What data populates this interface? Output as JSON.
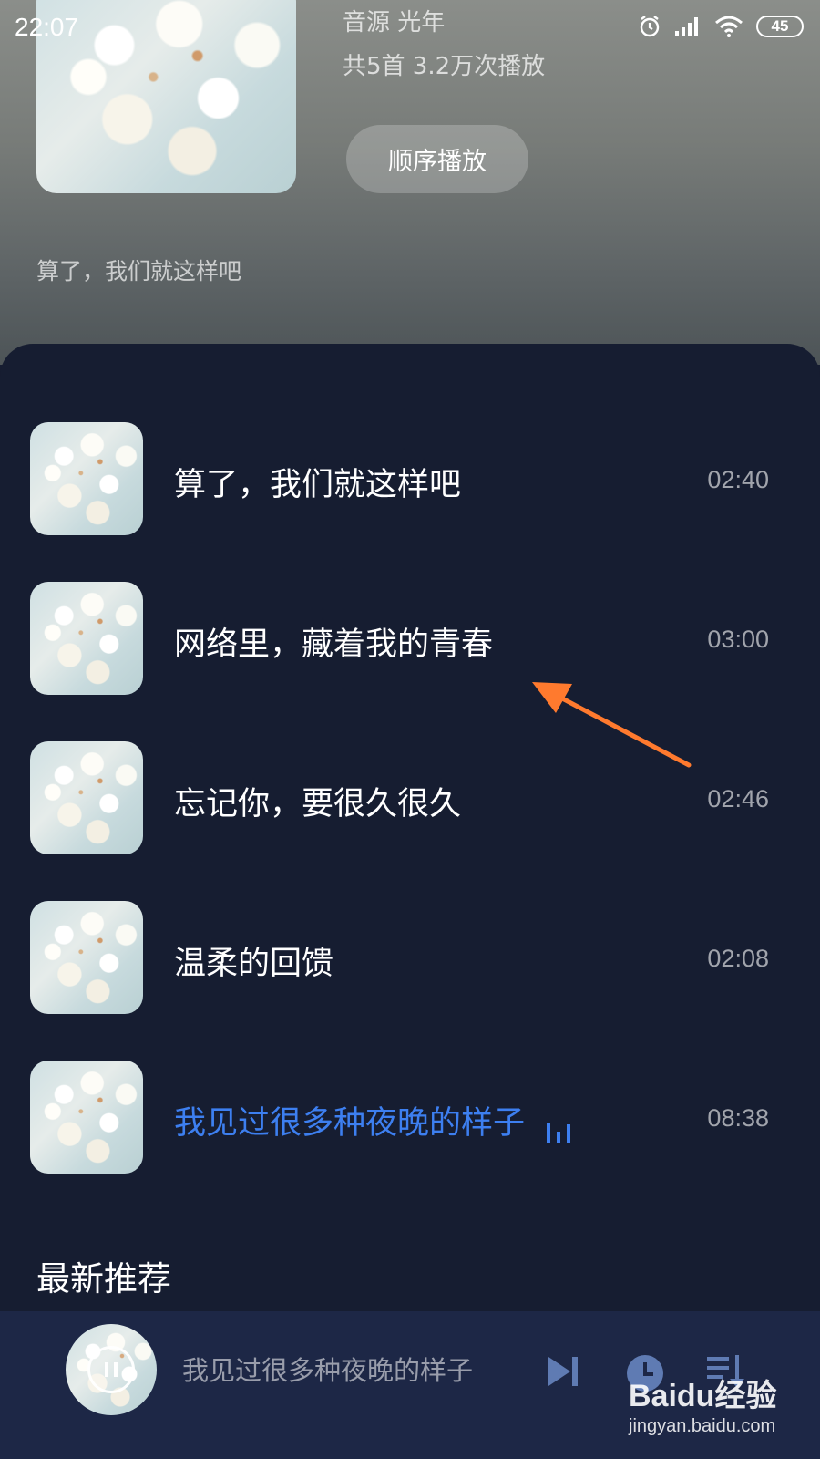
{
  "status_bar": {
    "time": "22:07",
    "battery": "45",
    "icons": [
      "alarm-icon",
      "signal-icon",
      "wifi-icon",
      "battery-icon"
    ]
  },
  "album": {
    "source_line": "音源  光年",
    "stats_line": "共5首  3.2万次播放",
    "play_mode_label": "顺序播放",
    "current_song_caption": "算了，我们就这样吧"
  },
  "songs": [
    {
      "title": "算了，我们就这样吧",
      "duration": "02:40",
      "active": false
    },
    {
      "title": "网络里，藏着我的青春",
      "duration": "03:00",
      "active": false
    },
    {
      "title": "忘记你，要很久很久",
      "duration": "02:46",
      "active": false
    },
    {
      "title": "温柔的回馈",
      "duration": "02:08",
      "active": false
    },
    {
      "title": "我见过很多种夜晚的样子",
      "duration": "08:38",
      "active": true
    }
  ],
  "section": {
    "recommend_title": "最新推荐"
  },
  "mini_player": {
    "title": "我见过很多种夜晚的样子",
    "icons": [
      "pause-icon",
      "next-icon",
      "timer-icon",
      "playlist-icon"
    ]
  },
  "watermark": {
    "brand": "Baidu经验",
    "url": "jingyan.baidu.com"
  },
  "colors": {
    "accent": "#3d7ff0",
    "panel_bg": "#161d31",
    "arrow": "#ff7a2e"
  }
}
